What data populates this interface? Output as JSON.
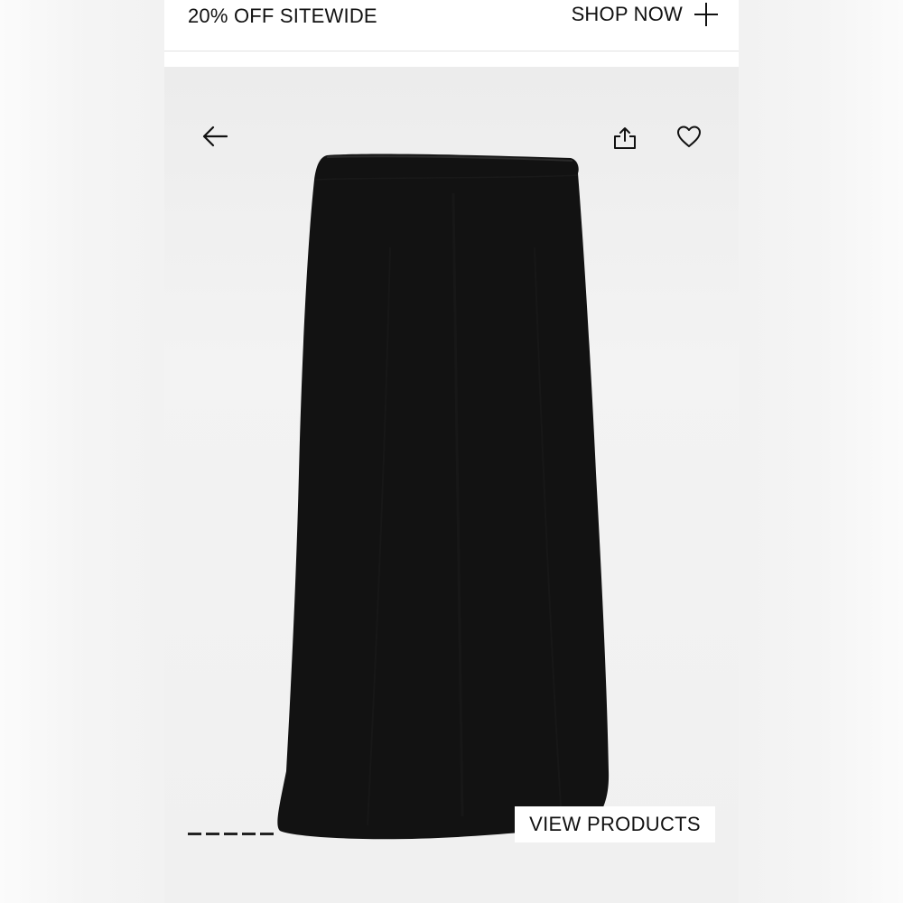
{
  "promo": {
    "text": "20% OFF SITEWIDE",
    "cta_label": "SHOP NOW",
    "cta_icon": "plus-icon"
  },
  "product_image": {
    "subject": "black midi skirt",
    "icons": {
      "back": "arrow-left-icon",
      "share": "share-icon",
      "favorite": "heart-icon"
    }
  },
  "view_products": {
    "label": "VIEW PRODUCTS"
  },
  "rating": {
    "icon": "rating-stars-icon",
    "count": 5
  },
  "colors": {
    "text": "#111111",
    "skirt": "#121212",
    "background": "#ffffff"
  }
}
